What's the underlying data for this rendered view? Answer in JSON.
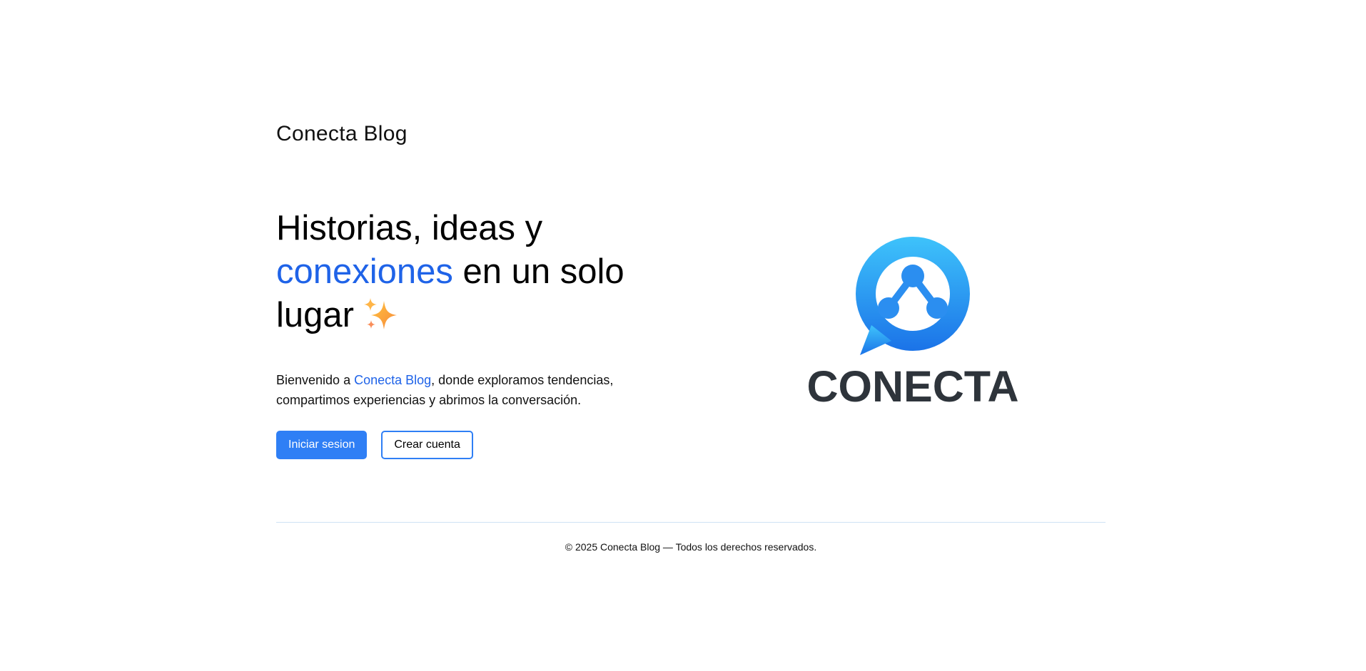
{
  "header": {
    "brand": "Conecta Blog"
  },
  "hero": {
    "headline_part1": "Historias, ideas y",
    "headline_accent": "conexiones",
    "headline_part2": "en un solo lugar",
    "intro_prefix": "Bienvenido a ",
    "intro_link": "Conecta Blog",
    "intro_suffix": ", donde exploramos tendencias, compartimos experiencias y abrimos la conversación.",
    "sparkles_icon": "sparkles-icon"
  },
  "actions": {
    "login_label": "Iniciar sesion",
    "register_label": "Crear cuenta"
  },
  "logo": {
    "wordmark": "CONECTA",
    "icon": "chat-network-icon"
  },
  "footer": {
    "text": "© 2025 Conecta Blog — Todos los derechos reservados."
  },
  "colors": {
    "accent": "#1f63e8",
    "button": "#2f7ff5",
    "logo_gradient_top": "#3ec3fb",
    "logo_gradient_bottom": "#1b73e8",
    "wordmark": "#2e343b",
    "divider": "#cfe3f5"
  }
}
